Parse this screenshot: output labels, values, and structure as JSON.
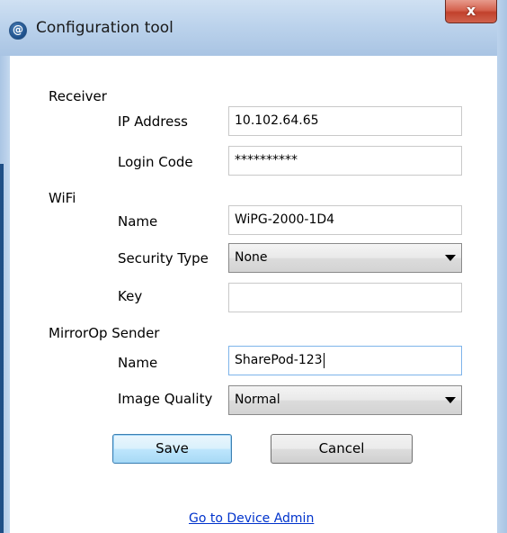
{
  "window": {
    "title": "Configuration tool",
    "icon": "app-icon",
    "close_label": "x"
  },
  "receiver": {
    "section_label": "Receiver",
    "ip_label": "IP Address",
    "ip_value": "10.102.64.65",
    "login_label": "Login Code",
    "login_value": "**********"
  },
  "wifi": {
    "section_label": "WiFi",
    "name_label": "Name",
    "name_value": "WiPG-2000-1D4",
    "security_label": "Security Type",
    "security_value": "None",
    "key_label": "Key",
    "key_value": ""
  },
  "sender": {
    "section_label": "MirrorOp Sender",
    "name_label": "Name",
    "name_value": "SharePod-123",
    "quality_label": "Image Quality",
    "quality_value": "Normal"
  },
  "buttons": {
    "save": "Save",
    "cancel": "Cancel"
  },
  "links": {
    "device_admin": "Go to Device Admin"
  },
  "colors": {
    "link": "#0033cc",
    "close_button": "#c1412c",
    "default_button_border": "#3c7fb1",
    "focus_border": "#7eb4ea"
  }
}
